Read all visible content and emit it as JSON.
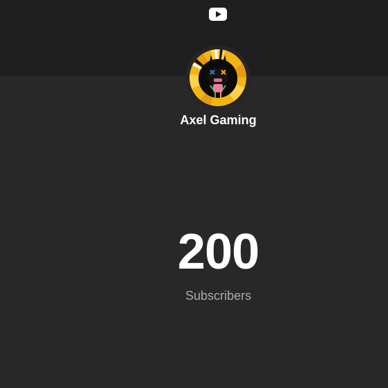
{
  "channel": {
    "name": "Axel Gaming",
    "subscriber_count": "200",
    "subscriber_label": "Subscribers"
  },
  "icons": {
    "logo": "youtube-logo-icon",
    "avatar": "channel-avatar"
  },
  "colors": {
    "background": "#282828",
    "banner": "#1e1e1e",
    "text_primary": "#ffffff",
    "text_secondary": "#aaaaaa"
  }
}
